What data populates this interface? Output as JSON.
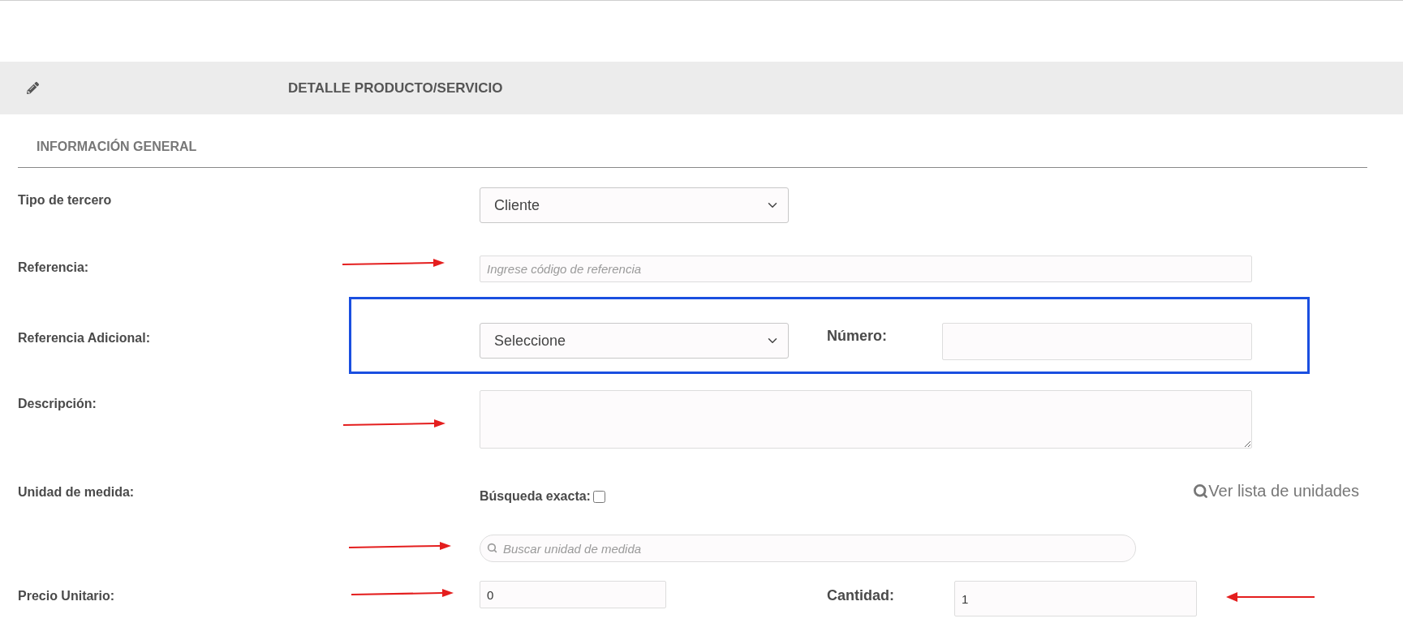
{
  "header": {
    "title": "DETALLE PRODUCTO/SERVICIO"
  },
  "section": {
    "title": "INFORMACIÓN GENERAL"
  },
  "rows": [
    {
      "kind": "select",
      "label": "Tipo de tercero",
      "value": "Cliente"
    },
    {
      "kind": "text",
      "label": "Referencia:",
      "placeholder": "Ingrese código de referencia",
      "arrow": true
    },
    {
      "kind": "select-number",
      "label": "Referencia Adicional:",
      "value": "Seleccione",
      "extra_label": "Número:",
      "highlighted": true
    },
    {
      "kind": "textarea",
      "label": "Descripción:",
      "arrow": true
    },
    {
      "kind": "unit",
      "label": "Unidad de medida:",
      "exact_label": "Búsqueda exacta:",
      "exact_checked": false,
      "link": "Ver lista de unidades",
      "placeholder": "Buscar unidad de medida",
      "arrow": true
    },
    {
      "kind": "price",
      "label": "Precio Unitario:",
      "value": "0",
      "arrow": true,
      "extra_label": "Cantidad:",
      "extra_value": "1",
      "extra_arrow": true
    }
  ]
}
